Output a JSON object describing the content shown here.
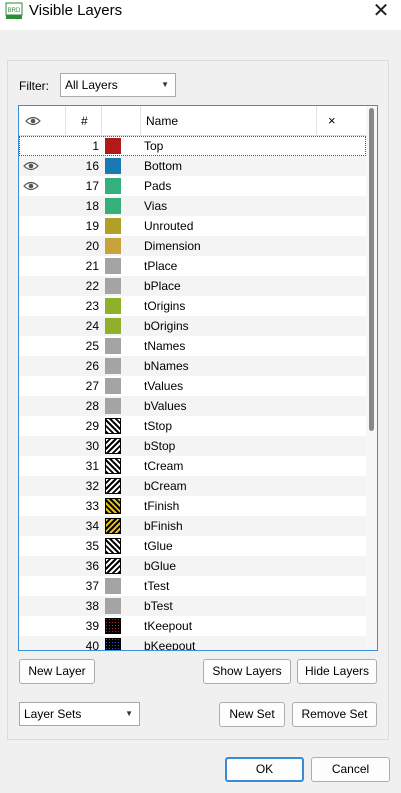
{
  "window": {
    "title": "Visible Layers",
    "app_icon_text": "BRD",
    "close_icon": "close-icon"
  },
  "filter": {
    "label": "Filter:",
    "value": "All Layers"
  },
  "table": {
    "columns": {
      "visible_icon": "eye-icon",
      "number": "#",
      "color": "",
      "name": "Name",
      "clear": "×"
    },
    "rows": [
      {
        "visible": false,
        "number": "1",
        "name": "Top",
        "color": "#b41919",
        "pattern": "solid"
      },
      {
        "visible": true,
        "number": "16",
        "name": "Bottom",
        "color": "#1a78b4",
        "pattern": "solid"
      },
      {
        "visible": true,
        "number": "17",
        "name": "Pads",
        "color": "#36b07a",
        "pattern": "solid"
      },
      {
        "visible": false,
        "number": "18",
        "name": "Vias",
        "color": "#36b07a",
        "pattern": "solid"
      },
      {
        "visible": false,
        "number": "19",
        "name": "Unrouted",
        "color": "#b0a02a",
        "pattern": "solid"
      },
      {
        "visible": false,
        "number": "20",
        "name": "Dimension",
        "color": "#c9a33a",
        "pattern": "solid"
      },
      {
        "visible": false,
        "number": "21",
        "name": "tPlace",
        "color": "#a4a4a4",
        "pattern": "solid"
      },
      {
        "visible": false,
        "number": "22",
        "name": "bPlace",
        "color": "#a4a4a4",
        "pattern": "solid"
      },
      {
        "visible": false,
        "number": "23",
        "name": "tOrigins",
        "color": "#8fb02a",
        "pattern": "solid"
      },
      {
        "visible": false,
        "number": "24",
        "name": "bOrigins",
        "color": "#8fb02a",
        "pattern": "solid"
      },
      {
        "visible": false,
        "number": "25",
        "name": "tNames",
        "color": "#a4a4a4",
        "pattern": "solid"
      },
      {
        "visible": false,
        "number": "26",
        "name": "bNames",
        "color": "#a4a4a4",
        "pattern": "solid"
      },
      {
        "visible": false,
        "number": "27",
        "name": "tValues",
        "color": "#a4a4a4",
        "pattern": "solid"
      },
      {
        "visible": false,
        "number": "28",
        "name": "bValues",
        "color": "#a4a4a4",
        "pattern": "solid"
      },
      {
        "visible": false,
        "number": "29",
        "name": "tStop",
        "color": "#ffffff",
        "pattern": "hatch-fwd"
      },
      {
        "visible": false,
        "number": "30",
        "name": "bStop",
        "color": "#ffffff",
        "pattern": "hatch-back"
      },
      {
        "visible": false,
        "number": "31",
        "name": "tCream",
        "color": "#ffffff",
        "pattern": "hatch-fwd"
      },
      {
        "visible": false,
        "number": "32",
        "name": "bCream",
        "color": "#ffffff",
        "pattern": "hatch-back"
      },
      {
        "visible": false,
        "number": "33",
        "name": "tFinish",
        "color": "#e6c21a",
        "pattern": "hatch-fwd"
      },
      {
        "visible": false,
        "number": "34",
        "name": "bFinish",
        "color": "#e6c21a",
        "pattern": "hatch-back"
      },
      {
        "visible": false,
        "number": "35",
        "name": "tGlue",
        "color": "#ffffff",
        "pattern": "hatch-fwd"
      },
      {
        "visible": false,
        "number": "36",
        "name": "bGlue",
        "color": "#ffffff",
        "pattern": "hatch-back"
      },
      {
        "visible": false,
        "number": "37",
        "name": "tTest",
        "color": "#a4a4a4",
        "pattern": "solid"
      },
      {
        "visible": false,
        "number": "38",
        "name": "bTest",
        "color": "#a4a4a4",
        "pattern": "solid"
      },
      {
        "visible": false,
        "number": "39",
        "name": "tKeepout",
        "color": "#c81e1e",
        "pattern": "dots"
      },
      {
        "visible": false,
        "number": "40",
        "name": "bKeepout",
        "color": "#2a5ad4",
        "pattern": "dots"
      }
    ]
  },
  "buttons": {
    "new_layer": "New Layer",
    "show_layers": "Show Layers",
    "hide_layers": "Hide Layers",
    "new_set": "New Set",
    "remove_set": "Remove Set",
    "ok": "OK",
    "cancel": "Cancel"
  },
  "layer_sets": {
    "value": "Layer Sets"
  },
  "colors": {
    "accent": "#3a8ad4",
    "table_border": "#3c8fd6"
  }
}
